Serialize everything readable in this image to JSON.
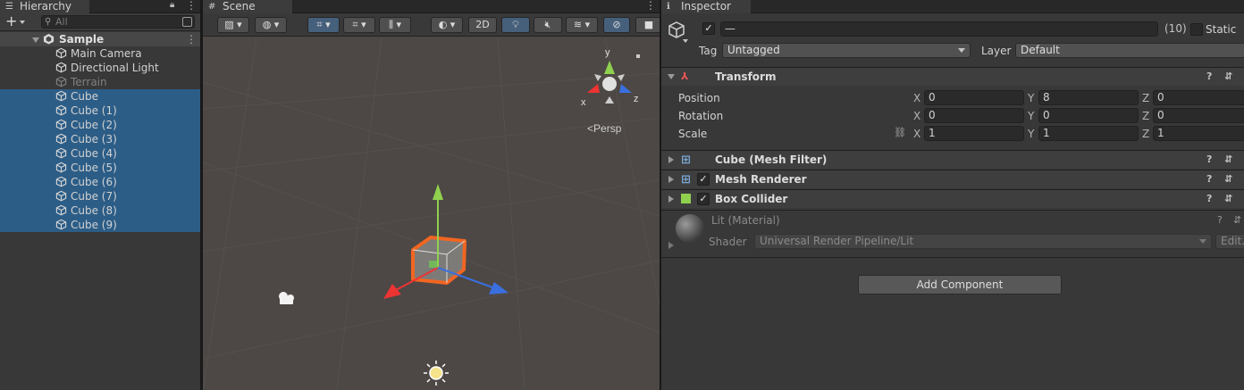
{
  "hierarchy": {
    "tab_label": "Hierarchy",
    "search_placeholder": "All",
    "scene_name": "Sample",
    "items": [
      {
        "label": "Main Camera"
      },
      {
        "label": "Directional Light"
      },
      {
        "label": "Terrain"
      },
      {
        "label": "Cube"
      },
      {
        "label": "Cube (1)"
      },
      {
        "label": "Cube (2)"
      },
      {
        "label": "Cube (3)"
      },
      {
        "label": "Cube (4)"
      },
      {
        "label": "Cube (5)"
      },
      {
        "label": "Cube (6)"
      },
      {
        "label": "Cube (7)"
      },
      {
        "label": "Cube (8)"
      },
      {
        "label": "Cube (9)"
      }
    ]
  },
  "scene": {
    "tab_label": "Scene",
    "toolbar": {
      "mode_2d": "2D"
    },
    "gizmo": {
      "y_label": "y",
      "x_label": "x",
      "z_label": "z",
      "projection": "Persp"
    }
  },
  "inspector": {
    "tab_label": "Inspector",
    "object_name": "—",
    "multi_count": "(10)",
    "static_label": "Static",
    "tag_label": "Tag",
    "tag_value": "Untagged",
    "layer_label": "Layer",
    "layer_value": "Default",
    "transform": {
      "title": "Transform",
      "position_label": "Position",
      "rotation_label": "Rotation",
      "scale_label": "Scale",
      "x": "X",
      "y": "Y",
      "z": "Z",
      "position": {
        "x": "0",
        "y": "8",
        "z": "0"
      },
      "rotation": {
        "x": "0",
        "y": "0",
        "z": "0"
      },
      "scale": {
        "x": "1",
        "y": "1",
        "z": "1"
      }
    },
    "components": [
      {
        "title": "Cube (Mesh Filter)"
      },
      {
        "title": "Mesh Renderer"
      },
      {
        "title": "Box Collider"
      }
    ],
    "material": {
      "name": "Lit (Material)",
      "shader_label": "Shader",
      "shader_value": "Universal Render Pipeline/Lit",
      "edit_label": "Edit..."
    },
    "add_component_label": "Add Component"
  },
  "colors": {
    "selection": "#2c5d87",
    "scene_bg": "#4d4845",
    "outline": "#f26522"
  }
}
